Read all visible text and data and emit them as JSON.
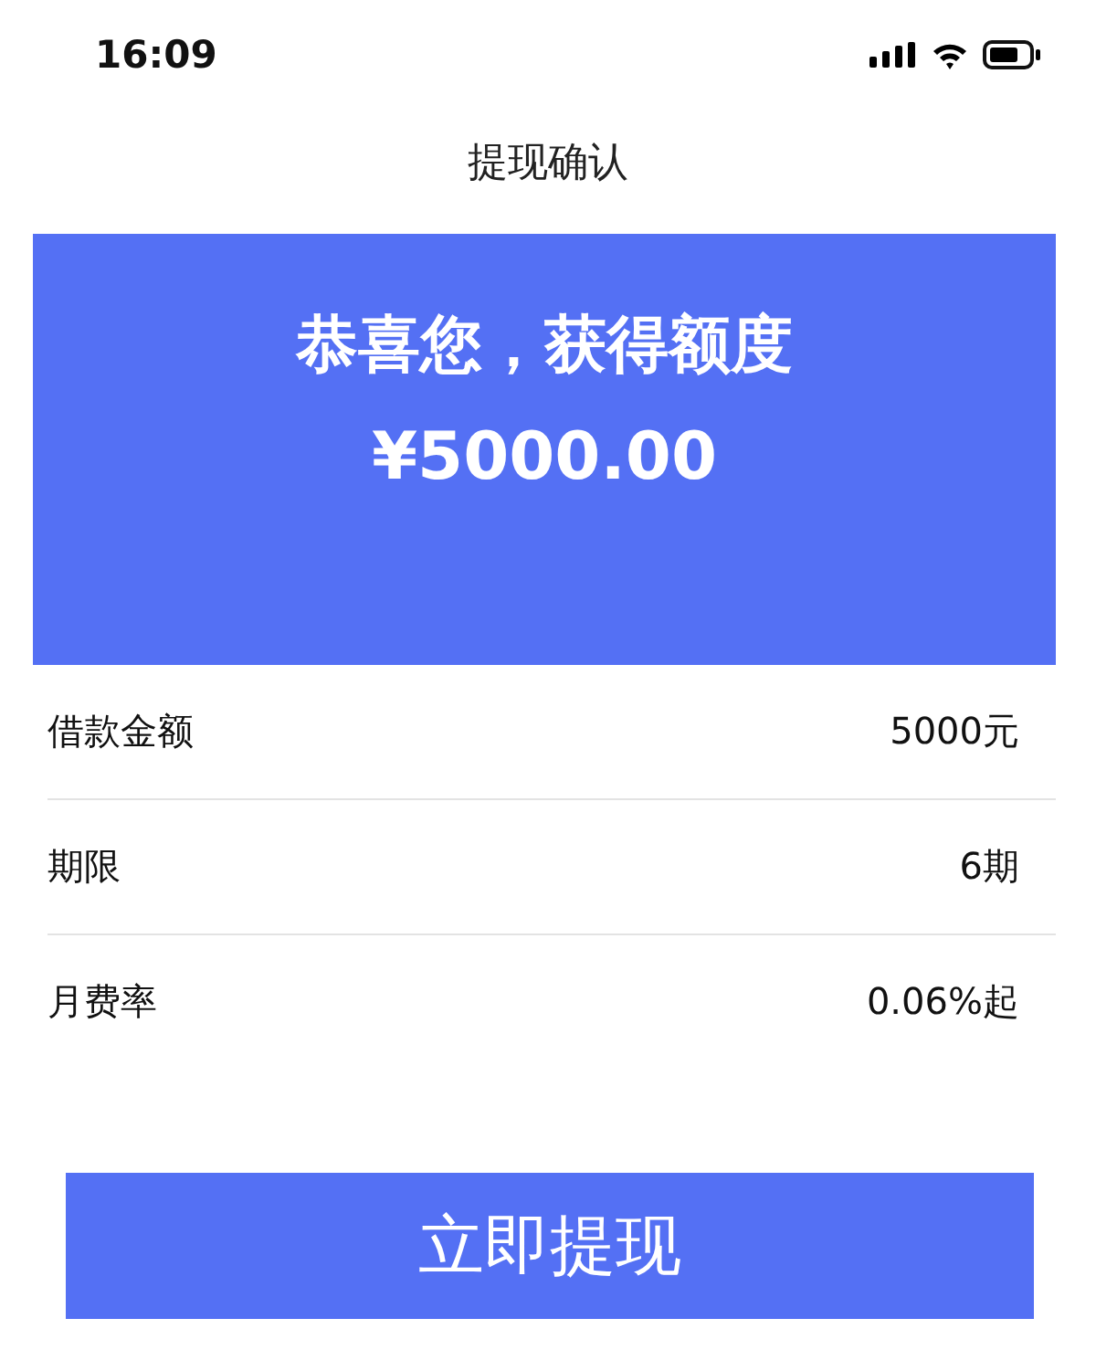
{
  "status_bar": {
    "time": "16:09"
  },
  "nav": {
    "title": "提现确认"
  },
  "banner": {
    "headline": "恭喜您，获得额度",
    "amount": "¥5000.00"
  },
  "rows": [
    {
      "label": "借款金额",
      "value": "5000元"
    },
    {
      "label": "期限",
      "value": "6期"
    },
    {
      "label": "月费率",
      "value": "0.06%起"
    }
  ],
  "button": {
    "label": "立即提现"
  }
}
